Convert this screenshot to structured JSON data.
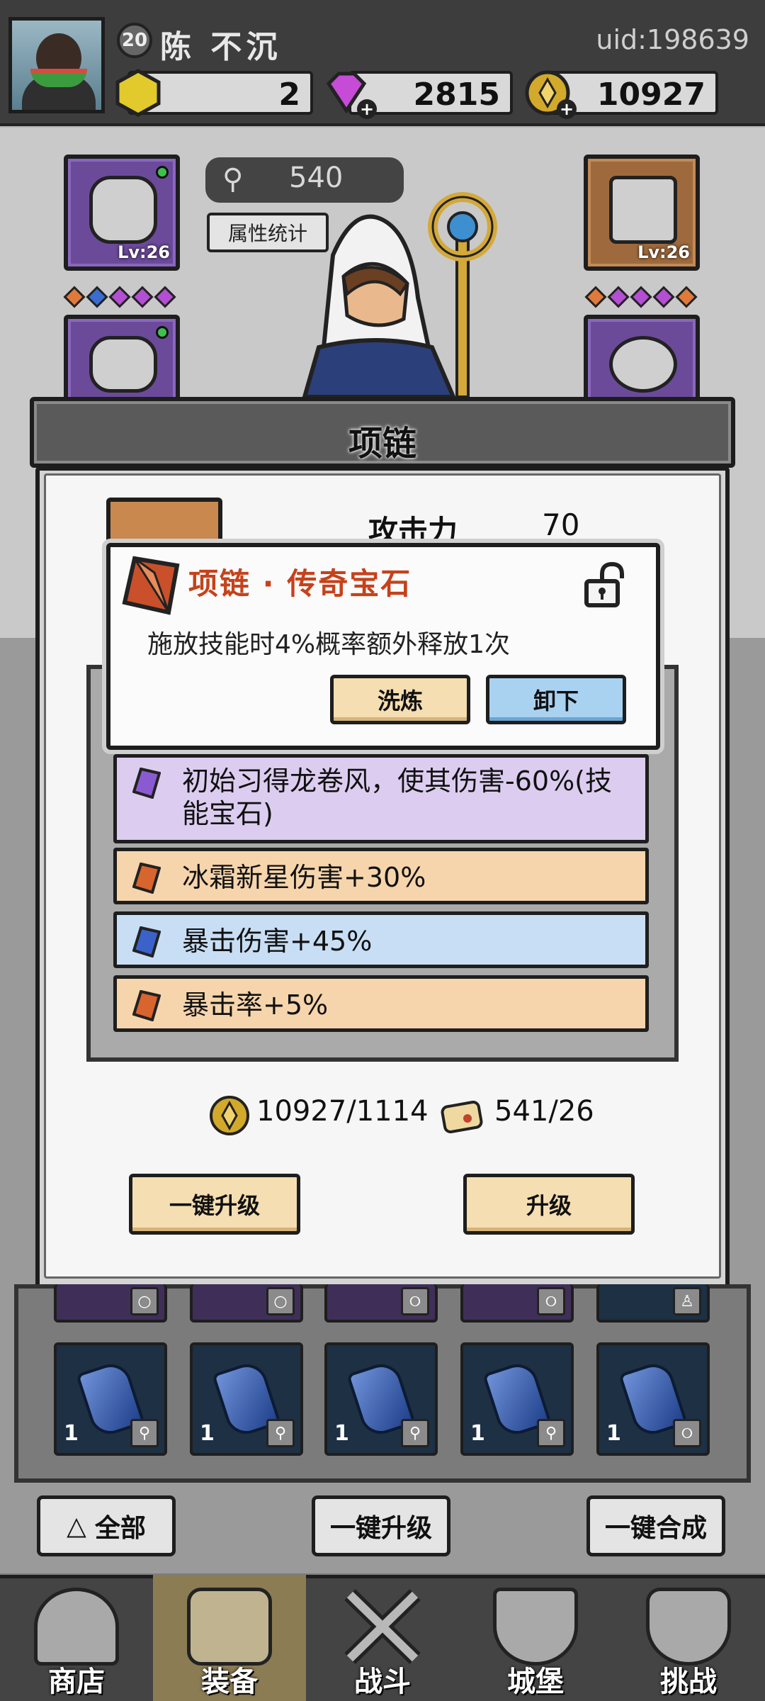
{
  "player": {
    "level": "20",
    "name": "陈 不沉",
    "uid": "uid:198639"
  },
  "currencies": {
    "yellow_gem": "2",
    "diamond": "2815",
    "gold": "10927"
  },
  "power_value": "540",
  "stats_button": "属性统计",
  "equipment_slots": {
    "helmet_level": "Lv:26",
    "gloves_level": "Lv:26"
  },
  "modal": {
    "title": "项链",
    "attack_label": "攻击力",
    "attack_value": "70",
    "popup": {
      "title": "项链 · 传奇宝石",
      "description": "施放技能时4%概率额外释放1次",
      "reforge_button": "洗炼",
      "unequip_button": "卸下"
    },
    "affixes": [
      {
        "text": "初始习得龙卷风，使其伤害-60%(技能宝石)",
        "color": "#d9c9ef"
      },
      {
        "text": "冰霜新星伤害+30%",
        "color": "#f6d5ac"
      },
      {
        "text": "暴击伤害+45%",
        "color": "#c8def4"
      },
      {
        "text": "暴击率+5%",
        "color": "#f6d5ac"
      }
    ],
    "cost_gold": "10927/1114",
    "cost_scroll": "541/26",
    "upgrade_all_button": "一键升级",
    "upgrade_button": "升级"
  },
  "inventory": {
    "row2_counts": [
      "1",
      "1",
      "1",
      "1",
      "1"
    ]
  },
  "footer_buttons": {
    "filter": "全部",
    "upgrade_all": "一键升级",
    "merge_all": "一键合成"
  },
  "tabs": [
    "商店",
    "装备",
    "战斗",
    "城堡",
    "挑战"
  ]
}
